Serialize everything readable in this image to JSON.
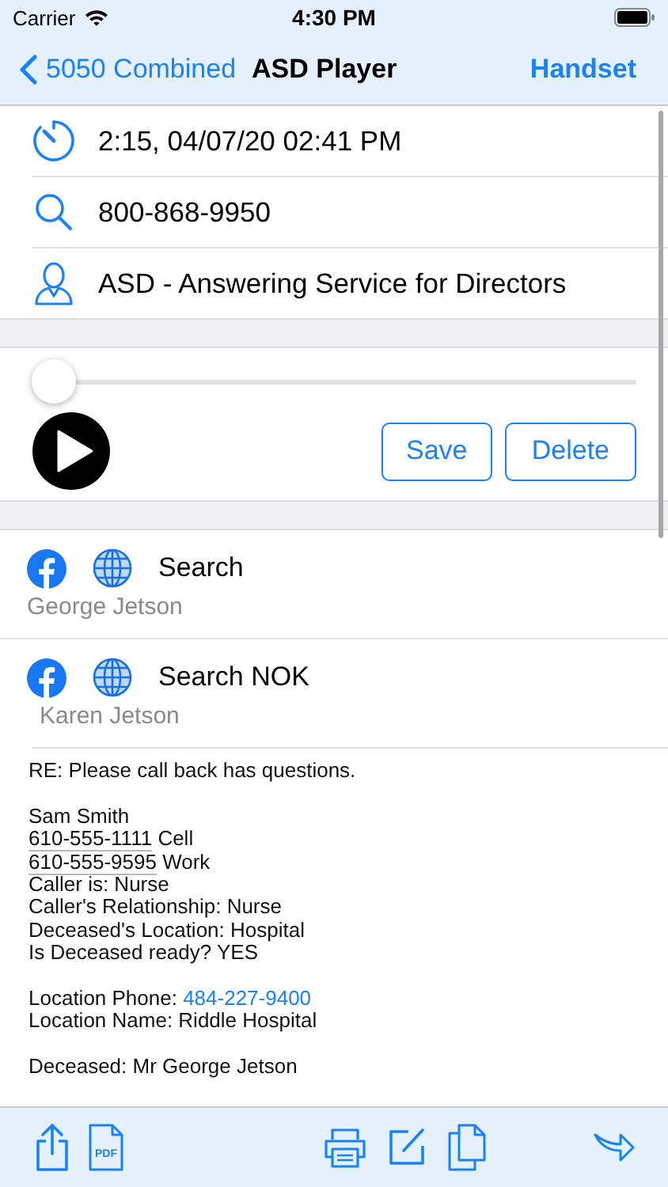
{
  "status_bar": {
    "carrier": "Carrier",
    "time": "4:30 PM"
  },
  "nav": {
    "back": "5050 Combined",
    "title": "ASD Player",
    "action": "Handset"
  },
  "info_rows": [
    {
      "kind": "timer",
      "text": "2:15, 04/07/20 02:41 PM"
    },
    {
      "kind": "search",
      "text": "800-868-9950"
    },
    {
      "kind": "person",
      "text": "ASD - Answering Service for Directors"
    }
  ],
  "player": {
    "level": 0,
    "buttons": [
      "Save",
      "Delete"
    ]
  },
  "search_rows": [
    {
      "label": "Search",
      "name": "George Jetson"
    },
    {
      "label": "Search NOK",
      "name": "Karen Jetson"
    }
  ],
  "notes": [
    [
      [
        {
          "kind": "plain",
          "text": "RE: Please call back has questions."
        }
      ]
    ],
    [
      [
        {
          "kind": "plain",
          "text": "Sam Smith"
        }
      ],
      [
        {
          "kind": "phone",
          "text": "610-555-1111"
        },
        {
          "kind": "plain",
          "text": " Cell"
        }
      ],
      [
        {
          "kind": "phone",
          "text": "610-555-9595"
        },
        {
          "kind": "plain",
          "text": " Work"
        }
      ],
      [
        {
          "kind": "plain",
          "text": "Caller is: Nurse"
        }
      ],
      [
        {
          "kind": "plain",
          "text": "Caller's Relationship: Nurse"
        }
      ],
      [
        {
          "kind": "plain",
          "text": "Deceased's Location: Hospital"
        }
      ],
      [
        {
          "kind": "plain",
          "text": "Is Deceased ready? YES"
        }
      ]
    ],
    [
      [
        {
          "kind": "plain",
          "text": "Location Phone: "
        },
        {
          "kind": "link",
          "text": "484-227-9400"
        }
      ],
      [
        {
          "kind": "plain",
          "text": "Location Name: Riddle Hospital"
        }
      ]
    ],
    [
      [
        {
          "kind": "plain",
          "text": "Deceased: Mr George Jetson"
        }
      ]
    ]
  ],
  "toolbar": {
    "pdf_label": "PDF"
  }
}
